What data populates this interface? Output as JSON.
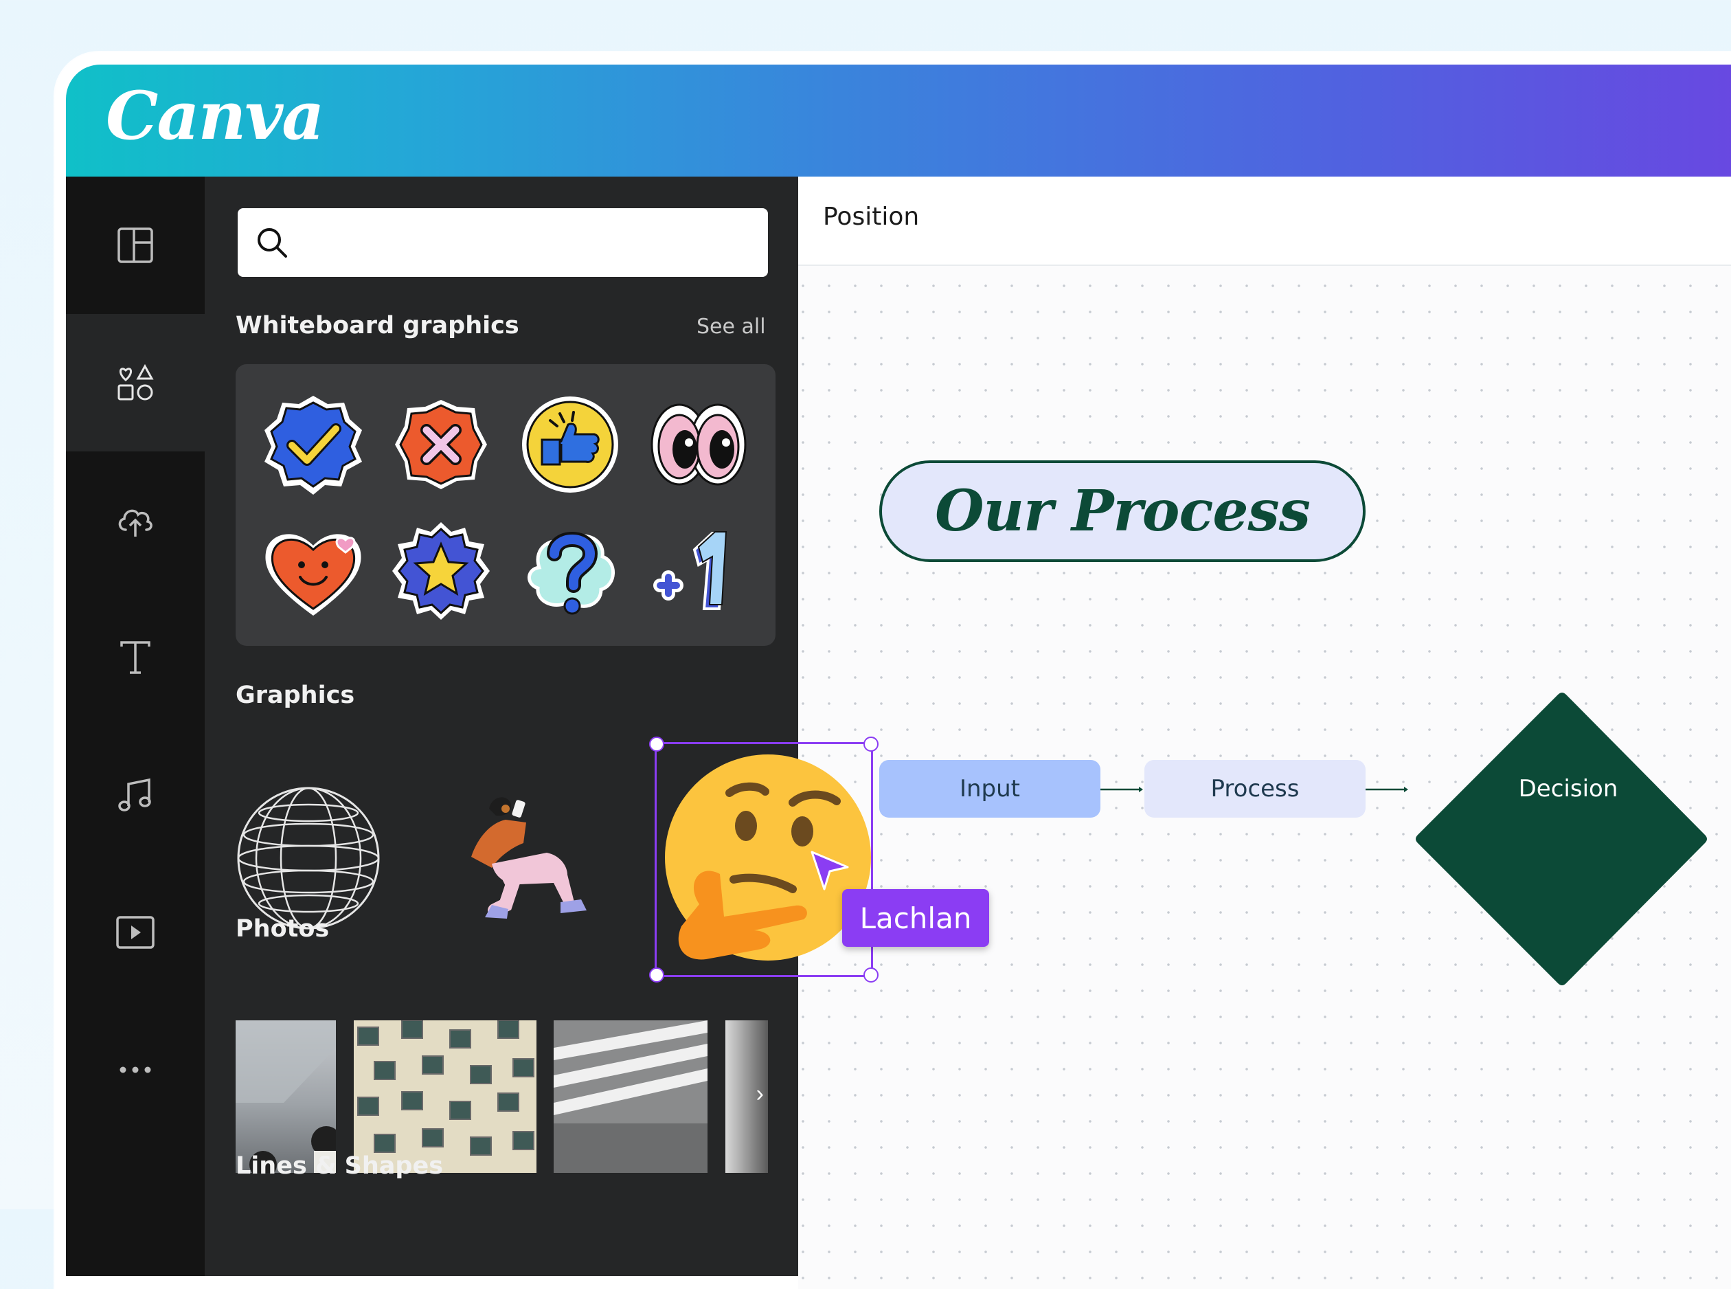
{
  "app": {
    "logo": "Canva"
  },
  "rail": {
    "items": [
      "layout-icon",
      "elements-icon",
      "upload-cloud-icon",
      "text-icon",
      "music-icon",
      "video-icon",
      "more-icon"
    ]
  },
  "panel": {
    "search": {
      "placeholder": ""
    },
    "whiteboard": {
      "title": "Whiteboard graphics",
      "see_all": "See all"
    },
    "graphics": {
      "title": "Graphics"
    },
    "photos": {
      "title": "Photos"
    },
    "lines": {
      "title": "Lines & Shapes"
    }
  },
  "canvas": {
    "toolbar_label": "Position",
    "title": "Our Process",
    "nodes": {
      "input": "Input",
      "process": "Process",
      "decision": "Decision"
    },
    "collaborator": "Lachlan"
  },
  "colors": {
    "accent_purple": "#8b3df3",
    "dark_green": "#0c4a37",
    "input_blue": "#a7c2fd",
    "process_lav": "#e3e7fb"
  }
}
